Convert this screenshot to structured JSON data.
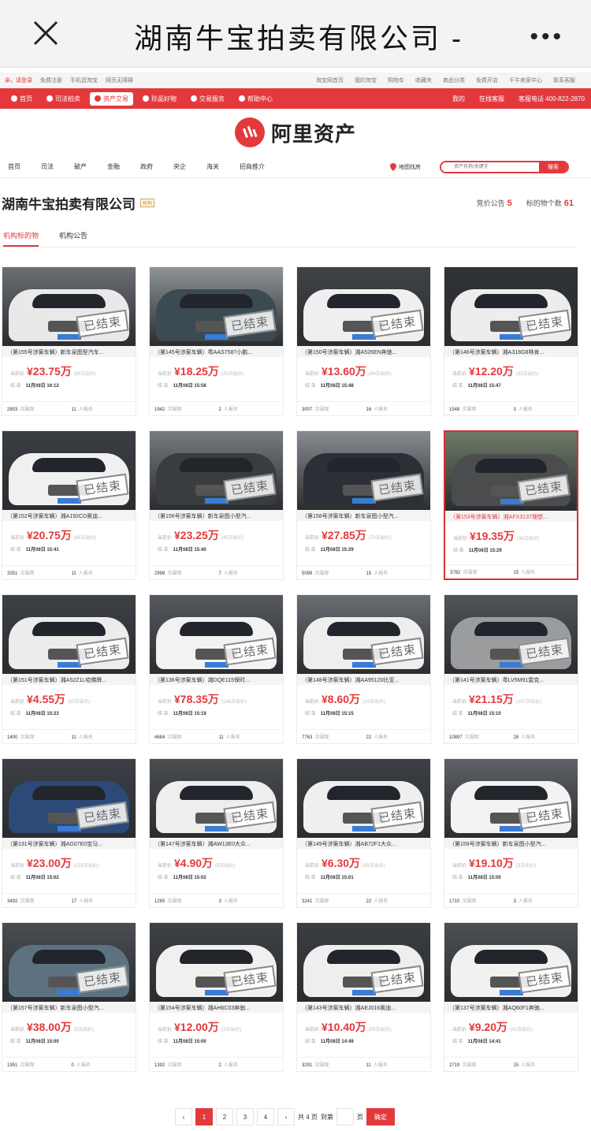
{
  "webview": {
    "title": "湖南牛宝拍卖有限公司 -",
    "more": "•••"
  },
  "topbar": {
    "left": [
      "亲，请登录",
      "免费注册",
      "手机逛淘宝",
      "网页无障碍"
    ],
    "right": [
      "淘宝网首页",
      "我的淘宝",
      "购物车",
      "收藏夹",
      "商品分类",
      "免费开店",
      "千牛卖家中心",
      "联系客服"
    ]
  },
  "rednav": {
    "items": [
      "首页",
      "司法拍卖",
      "资产交易",
      "珍品好物",
      "交易服务",
      "帮助中心"
    ],
    "active_index": 2,
    "right": [
      "我的",
      "在线客服",
      "客服电话 400-822-2870"
    ]
  },
  "logo": {
    "text": "阿里资产"
  },
  "catnav": {
    "items": [
      "首页",
      "司法",
      "破产",
      "金融",
      "政府",
      "央企",
      "海关",
      "招商推介"
    ],
    "map": "地图找房",
    "search_placeholder": "资产名称/关键字",
    "search_button": "搜索"
  },
  "org": {
    "name": "湖南牛宝拍卖有限公司",
    "tag": "机构",
    "notice_label": "竞价公告",
    "notice_count": "5",
    "items_label": "标的物个数",
    "items_count": "61",
    "tabs": [
      "机构标的物",
      "机构公告"
    ]
  },
  "labels": {
    "current_price": "当前价",
    "end": "结 束",
    "views": "次围观",
    "signups": "人报名",
    "stamp": "已结束"
  },
  "cards": [
    {
      "title": "（第155号涉案车辆）新车泉图型汽车...",
      "price": "¥23.75万",
      "bids": "(55次出价)",
      "end": "11月08日 16:12",
      "views": "2803",
      "signups": "11",
      "body": "#e9e9e9",
      "bg": "#6b6f74"
    },
    {
      "title": "（第145号涉案车辆）粤AAS7587小鹏...",
      "price": "¥18.25万",
      "bids": "(25次出价)",
      "end": "11月08日 15:58",
      "views": "1942",
      "signups": "2",
      "body": "#3c4a52",
      "bg": "#8d9396"
    },
    {
      "title": "（第150号涉案车辆）湘A526EN奔驰...",
      "price": "¥13.60万",
      "bids": "(94次出价)",
      "end": "11月08日 15:48",
      "views": "3007",
      "signups": "16",
      "body": "#efefef",
      "bg": "#3f4246"
    },
    {
      "title": "（第146号涉案车辆）湘A318G8林肯...",
      "price": "¥12.20万",
      "bids": "(33次出价)",
      "end": "11月08日 15:47",
      "views": "1548",
      "signups": "3",
      "body": "#ededed",
      "bg": "#2f3236"
    },
    {
      "title": "（第152号涉案车辆）湘A192CD奥迪...",
      "price": "¥20.75万",
      "bids": "(68次出价)",
      "end": "11月08日 15:41",
      "views": "3351",
      "signups": "11",
      "body": "#f0f0f0",
      "bg": "#3b3e42"
    },
    {
      "title": "（第156号涉案车辆）新车泉图小型汽...",
      "price": "¥23.25万",
      "bids": "(45次出价)",
      "end": "11月08日 15:40",
      "views": "2998",
      "signups": "7",
      "body": "#3a3d40",
      "bg": "#777b7e"
    },
    {
      "title": "（第158号涉案车辆）新车泉图小型汽...",
      "price": "¥27.85万",
      "bids": "(73次出价)",
      "end": "11月08日 15:29",
      "views": "5099",
      "signups": "15",
      "body": "#2a3036",
      "bg": "#888c90"
    },
    {
      "title": "（第153号涉案车辆）湘AFX3137理想...",
      "price": "¥19.35万",
      "bids": "(36次出价)",
      "end": "11月08日 15:29",
      "views": "3782",
      "signups": "15",
      "body": "#4a4c4e",
      "bg": "#6e7a68"
    },
    {
      "title": "（第151号涉案车辆）湘A52Z1L哈佛牌...",
      "price": "¥4.55万",
      "bids": "(10次出价)",
      "end": "11月08日 15:23",
      "views": "1400",
      "signups": "11",
      "body": "#ececec",
      "bg": "#3d4044"
    },
    {
      "title": "（第136号涉案车辆）湘DQE115保时...",
      "price": "¥78.35万",
      "bids": "(144次出价)",
      "end": "11月08日 15:19",
      "views": "4684",
      "signups": "11",
      "body": "#f2f2f2",
      "bg": "#55595d"
    },
    {
      "title": "（第148号涉案车辆）湘AA95120比亚...",
      "price": "¥8.60万",
      "bids": "(16次出价)",
      "end": "11月08日 15:15",
      "views": "7763",
      "signups": "22",
      "body": "#eeeeee",
      "bg": "#6a6e72"
    },
    {
      "title": "（第141号涉案车辆）粤LV5M91雷克...",
      "price": "¥21.15万",
      "bids": "(137次出价)",
      "end": "11月08日 15:10",
      "views": "10897",
      "signups": "28",
      "body": "#9a9c9e",
      "bg": "#505458"
    },
    {
      "title": "（第131号涉案车辆）湘AG07E0宝马...",
      "price": "¥23.00万",
      "bids": "(139次出价)",
      "end": "11月08日 15:02",
      "views": "3492",
      "signups": "17",
      "body": "#2c4a78",
      "bg": "#3c4046"
    },
    {
      "title": "（第147号涉案车辆）湘AW13E0大众...",
      "price": "¥4.90万",
      "bids": "(3次出价)",
      "end": "11月08日 15:02",
      "views": "1265",
      "signups": "3",
      "body": "#eeeeee",
      "bg": "#4a4d50"
    },
    {
      "title": "（第149号涉案车辆）湘AB72F1大众...",
      "price": "¥6.30万",
      "bids": "(56次出价)",
      "end": "11月08日 15:01",
      "views": "3241",
      "signups": "22",
      "body": "#efefef",
      "bg": "#3c3f43"
    },
    {
      "title": "（第159号涉案车辆）新车泉图小型汽...",
      "price": "¥19.10万",
      "bids": "(3次出价)",
      "end": "11月08日 15:00",
      "views": "1710",
      "signups": "3",
      "body": "#f3f3f3",
      "bg": "#5e6266"
    },
    {
      "title": "（第157号涉案车辆）新车泉图小型汽...",
      "price": "¥38.00万",
      "bids": "(0次出价)",
      "end": "11月08日 15:00",
      "views": "1951",
      "signups": "0",
      "body": "#5d7280",
      "bg": "#4a4e52"
    },
    {
      "title": "（第154号涉案车辆）湘AH6C03奔驰...",
      "price": "¥12.00万",
      "bids": "(3次出价)",
      "end": "11月08日 15:00",
      "views": "1392",
      "signups": "2",
      "body": "#f0f0f0",
      "bg": "#3e4145"
    },
    {
      "title": "（第143号涉案车辆）湘AEJ016奥迪...",
      "price": "¥10.40万",
      "bids": "(59次出价)",
      "end": "11月08日 14:49",
      "views": "3291",
      "signups": "11",
      "body": "#eeeeee",
      "bg": "#3a3d41"
    },
    {
      "title": "（第137号涉案车辆）湘AQ60F1奔驰...",
      "price": "¥9.20万",
      "bids": "(41次出价)",
      "end": "11月08日 14:41",
      "views": "2719",
      "signups": "15",
      "body": "#f1f1f1",
      "bg": "#4d5155"
    }
  ],
  "selected_card": 7,
  "pager": {
    "prev": "‹",
    "pages": [
      "1",
      "2",
      "3",
      "4"
    ],
    "next": "›",
    "total": "共 4 页",
    "goto": "到第",
    "page_unit": "页",
    "confirm": "确定"
  }
}
